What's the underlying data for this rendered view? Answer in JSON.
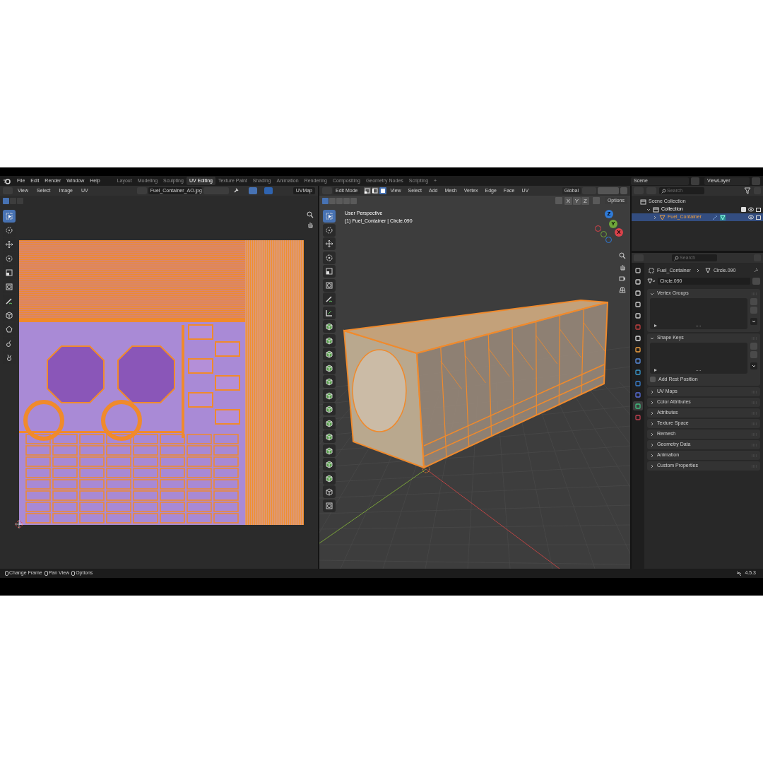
{
  "top_bar": {
    "menus": [
      "File",
      "Edit",
      "Render",
      "Window",
      "Help"
    ],
    "workspaces": [
      {
        "label": "Layout",
        "selected": false
      },
      {
        "label": "Modeling",
        "selected": false
      },
      {
        "label": "Sculpting",
        "selected": false
      },
      {
        "label": "UV Editing",
        "selected": true
      },
      {
        "label": "Texture Paint",
        "selected": false
      },
      {
        "label": "Shading",
        "selected": false
      },
      {
        "label": "Animation",
        "selected": false
      },
      {
        "label": "Rendering",
        "selected": false
      },
      {
        "label": "Compositing",
        "selected": false
      },
      {
        "label": "Geometry Nodes",
        "selected": false
      },
      {
        "label": "Scripting",
        "selected": false
      }
    ],
    "add_workspace": "+",
    "scene": "Scene",
    "view_layer": "ViewLayer"
  },
  "uv_editor": {
    "menus": [
      "View",
      "Select",
      "Image",
      "UV"
    ],
    "image": "Fuel_Container_AO.jpg",
    "uv_map": "UVMap",
    "tools": [
      {
        "kind": "select_box",
        "selected": true
      },
      {
        "kind": "cursor",
        "selected": false
      },
      {
        "kind": "move",
        "selected": false
      },
      {
        "kind": "rotate",
        "selected": false
      },
      {
        "kind": "scale",
        "selected": false
      },
      {
        "kind": "transform",
        "selected": false
      },
      {
        "kind": "annotate",
        "selected": false
      },
      {
        "kind": "rip",
        "selected": false
      },
      {
        "kind": "grab",
        "selected": false
      },
      {
        "kind": "relax",
        "selected": false
      },
      {
        "kind": "pinch",
        "selected": false
      }
    ]
  },
  "viewport": {
    "mode": "Edit Mode",
    "menus": [
      "View",
      "Select",
      "Add",
      "Mesh",
      "Vertex",
      "Edge",
      "Face",
      "UV"
    ],
    "select_modes": [
      {
        "kind": "vertex",
        "selected": false
      },
      {
        "kind": "edge",
        "selected": false
      },
      {
        "kind": "face",
        "selected": true
      }
    ],
    "orientation": "Global",
    "mirror_axes": [
      "X",
      "Y",
      "Z"
    ],
    "options": "Options",
    "view_name": "User Perspective",
    "object_info": "(1) Fuel_Container | Circle.090",
    "gizmo_axes": [
      {
        "label": "Z",
        "color": "#2f7bd8"
      },
      {
        "label": "Y",
        "color": "#6ea63a"
      },
      {
        "label": "X",
        "color": "#d9424a"
      }
    ],
    "tools": [
      {
        "kind": "select_box",
        "selected": true
      },
      {
        "kind": "cursor",
        "selected": false
      },
      {
        "kind": "move",
        "selected": false
      },
      {
        "kind": "rotate",
        "selected": false
      },
      {
        "kind": "scale",
        "selected": false
      },
      {
        "kind": "transform",
        "selected": false
      },
      {
        "kind": "annotate",
        "selected": false
      },
      {
        "kind": "measure",
        "selected": false
      },
      {
        "kind": "add_cube",
        "selected": false
      },
      {
        "kind": "extrude",
        "selected": false
      },
      {
        "kind": "inset",
        "selected": false
      },
      {
        "kind": "bevel",
        "selected": false
      },
      {
        "kind": "loop_cut",
        "selected": false
      },
      {
        "kind": "knife",
        "selected": false
      },
      {
        "kind": "poly_build",
        "selected": false
      },
      {
        "kind": "spin",
        "selected": false
      },
      {
        "kind": "smooth",
        "selected": false
      },
      {
        "kind": "shrink",
        "selected": false
      },
      {
        "kind": "shear",
        "selected": false
      },
      {
        "kind": "to_sphere",
        "selected": false
      },
      {
        "kind": "rip",
        "selected": false
      },
      {
        "kind": "transform",
        "selected": false
      }
    ]
  },
  "outliner": {
    "search_placeholder": "Search",
    "tree": [
      {
        "label": "Scene Collection",
        "kind": "scene",
        "selected": false,
        "children": [
          {
            "label": "Collection",
            "kind": "collection",
            "selected": false,
            "expanded": true,
            "children": [
              {
                "label": "Fuel_Container",
                "kind": "object",
                "selected": true,
                "expanded": false
              }
            ]
          }
        ]
      }
    ]
  },
  "properties": {
    "search_placeholder": "Search",
    "breadcrumb": [
      "Fuel_Container",
      "Circle.090"
    ],
    "mesh_name": "Circle.090",
    "tabs": [
      {
        "kind": "tool",
        "selected": false
      },
      {
        "kind": "render",
        "selected": false
      },
      {
        "kind": "output",
        "selected": false
      },
      {
        "kind": "view_layer",
        "selected": false
      },
      {
        "kind": "scene",
        "selected": false
      },
      {
        "kind": "world",
        "selected": false
      },
      {
        "kind": "collection",
        "selected": false
      },
      {
        "kind": "object",
        "selected": false
      },
      {
        "kind": "modifiers",
        "selected": false
      },
      {
        "kind": "particles",
        "selected": false
      },
      {
        "kind": "physics",
        "selected": false
      },
      {
        "kind": "constraints",
        "selected": false
      },
      {
        "kind": "data",
        "selected": true
      },
      {
        "kind": "material",
        "selected": false
      }
    ],
    "panels": [
      {
        "label": "Vertex Groups",
        "expanded": true
      },
      {
        "label": "Shape Keys",
        "expanded": true,
        "checkbox": {
          "label": "Add Rest Position",
          "checked": false
        }
      },
      {
        "label": "UV Maps",
        "expanded": false
      },
      {
        "label": "Color Attributes",
        "expanded": false
      },
      {
        "label": "Attributes",
        "expanded": false
      },
      {
        "label": "Texture Space",
        "expanded": false
      },
      {
        "label": "Remesh",
        "expanded": false
      },
      {
        "label": "Geometry Data",
        "expanded": false
      },
      {
        "label": "Animation",
        "expanded": false
      },
      {
        "label": "Custom Properties",
        "expanded": false
      }
    ]
  },
  "status_bar": {
    "hints": [
      "Change Frame",
      "Pan View",
      "Options"
    ],
    "version": "4.5.3"
  }
}
